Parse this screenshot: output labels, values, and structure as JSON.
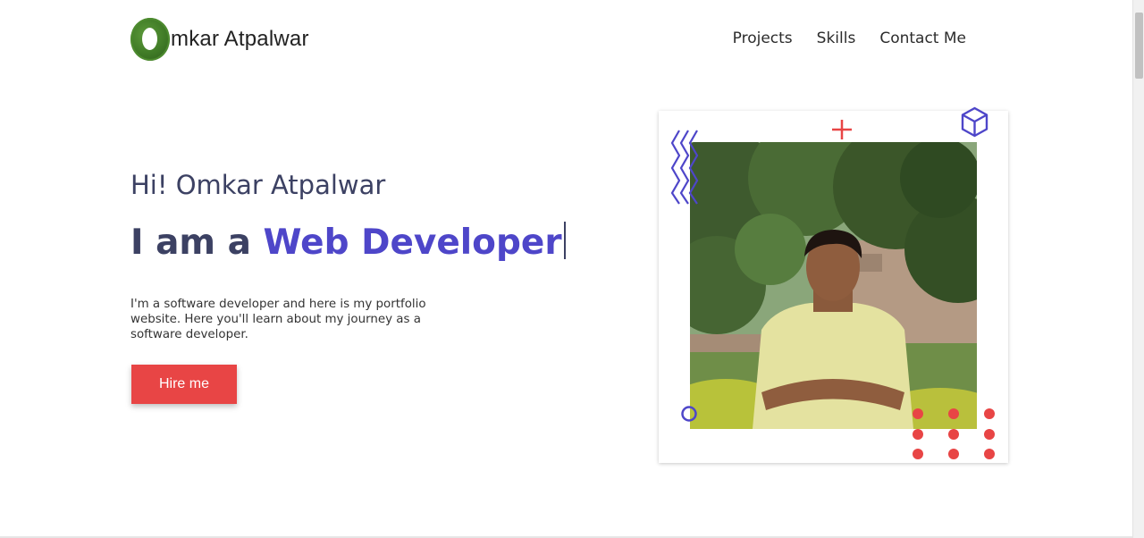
{
  "nav": {
    "logo_text": "mkar Atpalwar",
    "links": [
      "Projects",
      "Skills",
      "Contact Me"
    ]
  },
  "hero": {
    "greeting": "Hi! Omkar Atpalwar",
    "role_prefix": "I am a ",
    "role_highlight": "Web Developer",
    "bio": "I'm a software developer and here is my portfolio website. Here you'll learn about my journey as a software developer.",
    "hire_button": "Hire me"
  },
  "icons": {
    "zigzag": "zigzag-icon",
    "plus": "plus-icon",
    "cube": "cube-icon",
    "ring": "ring-icon",
    "dots": "dot-grid-icon"
  },
  "colors": {
    "accent_purple": "#4e46c9",
    "accent_red": "#e84545",
    "text_dark": "#3c4163"
  }
}
